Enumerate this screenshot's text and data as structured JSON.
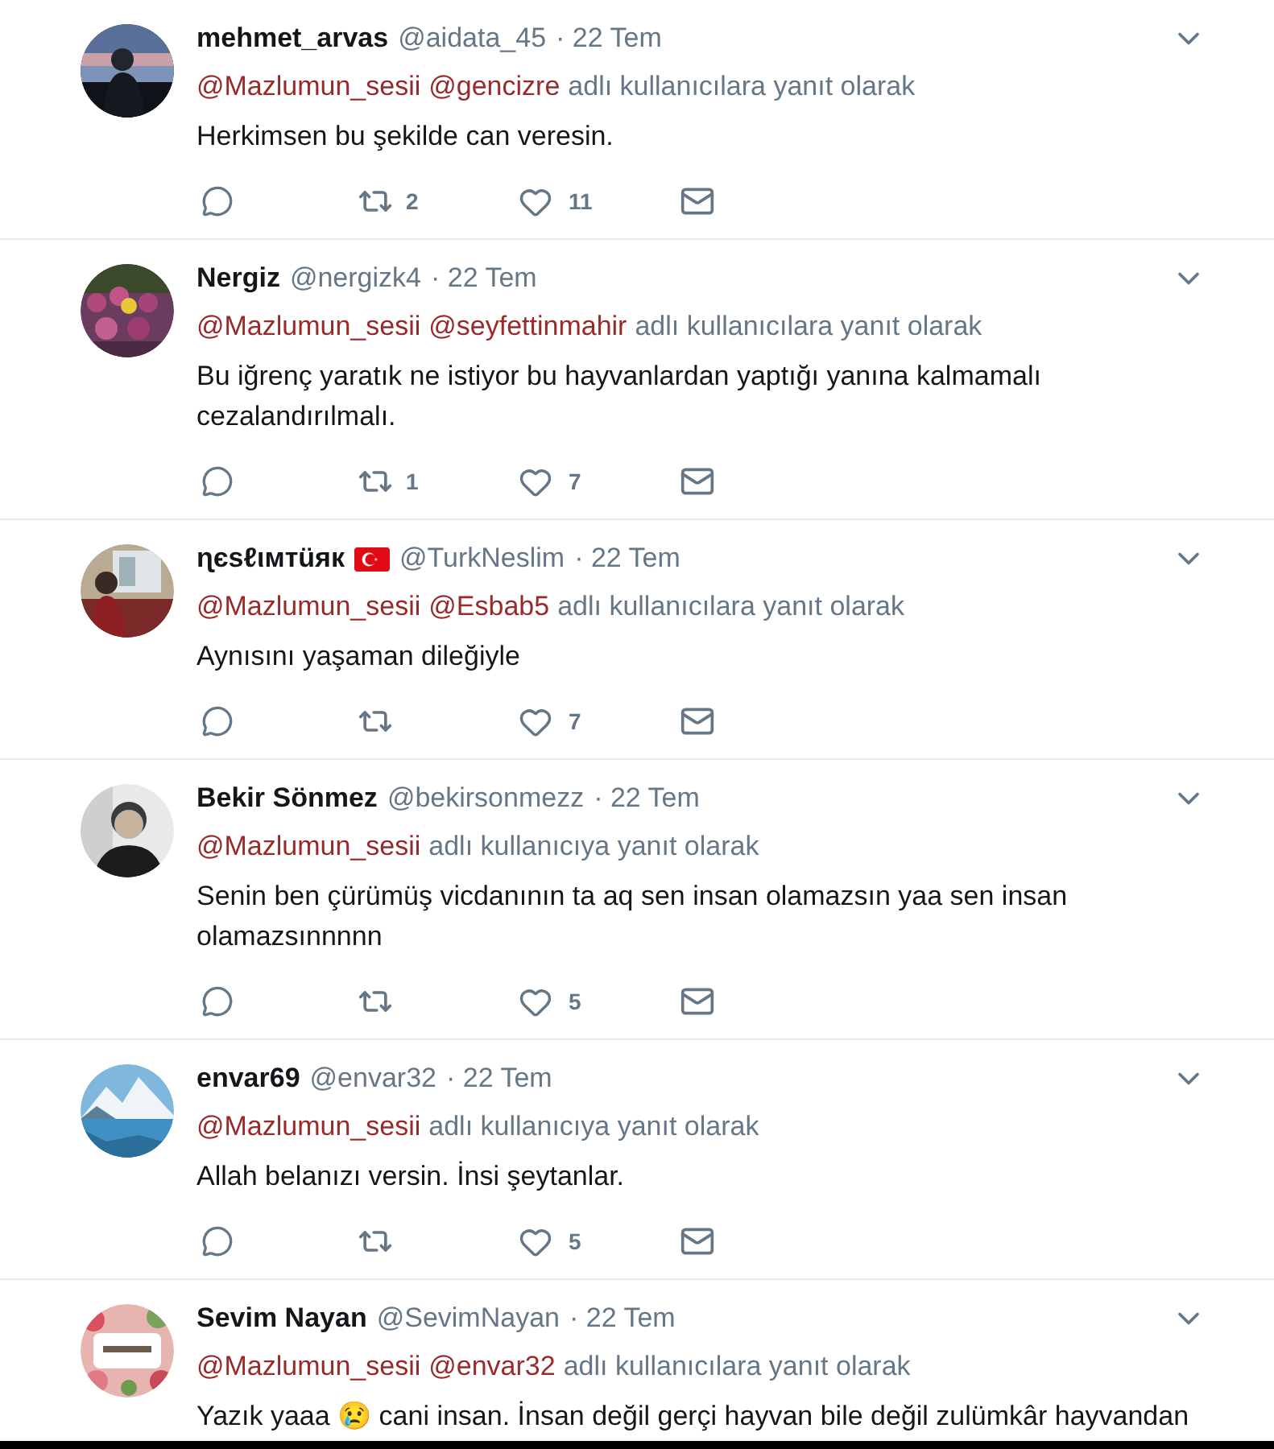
{
  "tweets": [
    {
      "avatar": {
        "kind": "picture"
      },
      "name": "mehmet_arvas",
      "flag": false,
      "handle": "@aidata_45",
      "time": "· 22 Tem",
      "mentions": [
        "@Mazlumun_sesii",
        "@gencizre"
      ],
      "reply_suffix": "adlı kullanıcılara yanıt olarak",
      "text": "Herkimsen bu şekilde can veresin.",
      "actions": {
        "retweets": "2",
        "likes": "11"
      }
    },
    {
      "avatar": {
        "kind": "picture"
      },
      "name": "Nergiz",
      "flag": false,
      "handle": "@nergizk4",
      "time": "· 22 Tem",
      "mentions": [
        "@Mazlumun_sesii",
        "@seyfettinmahir"
      ],
      "reply_suffix": "adlı kullanıcılara yanıt olarak",
      "text": "Bu iğrenç yaratık ne istiyor bu hayvanlardan yaptığı yanına kalmamalı cezalandırılmalı.",
      "actions": {
        "retweets": "1",
        "likes": "7"
      }
    },
    {
      "avatar": {
        "kind": "picture"
      },
      "name": "ɳєѕℓιмтüяк",
      "flag": true,
      "handle": "@TurkNeslim",
      "time": "· 22 Tem",
      "mentions": [
        "@Mazlumun_sesii",
        "@Esbab5"
      ],
      "reply_suffix": "adlı kullanıcılara yanıt olarak",
      "text": "Aynısını yaşaman dileğiyle",
      "actions": {
        "likes": "7"
      }
    },
    {
      "avatar": {
        "kind": "picture"
      },
      "name": "Bekir Sönmez",
      "flag": false,
      "handle": "@bekirsonmezz",
      "time": "· 22 Tem",
      "mentions": [
        "@Mazlumun_sesii"
      ],
      "reply_suffix": "adlı kullanıcıya yanıt olarak",
      "text": "Senin ben çürümüş vicdanının ta aq sen insan olamazsın yaa sen insan olamazsınnnnn",
      "actions": {
        "likes": "5"
      }
    },
    {
      "avatar": {
        "kind": "picture"
      },
      "name": "envar69",
      "flag": false,
      "handle": "@envar32",
      "time": "· 22 Tem",
      "mentions": [
        "@Mazlumun_sesii"
      ],
      "reply_suffix": "adlı kullanıcıya yanıt olarak",
      "text": "Allah belanızı versin. İnsi şeytanlar.",
      "actions": {
        "likes": "5"
      }
    },
    {
      "avatar": {
        "kind": "picture"
      },
      "name": "Sevim Nayan",
      "flag": false,
      "handle": "@SevimNayan",
      "time": "· 22 Tem",
      "mentions": [
        "@Mazlumun_sesii",
        "@envar32"
      ],
      "reply_suffix": "adlı kullanıcılara yanıt olarak",
      "text": "Yazık yaaa 😢 cani insan. İnsan değil gerçi hayvan bile değil zulümkâr hayvandan"
    }
  ]
}
